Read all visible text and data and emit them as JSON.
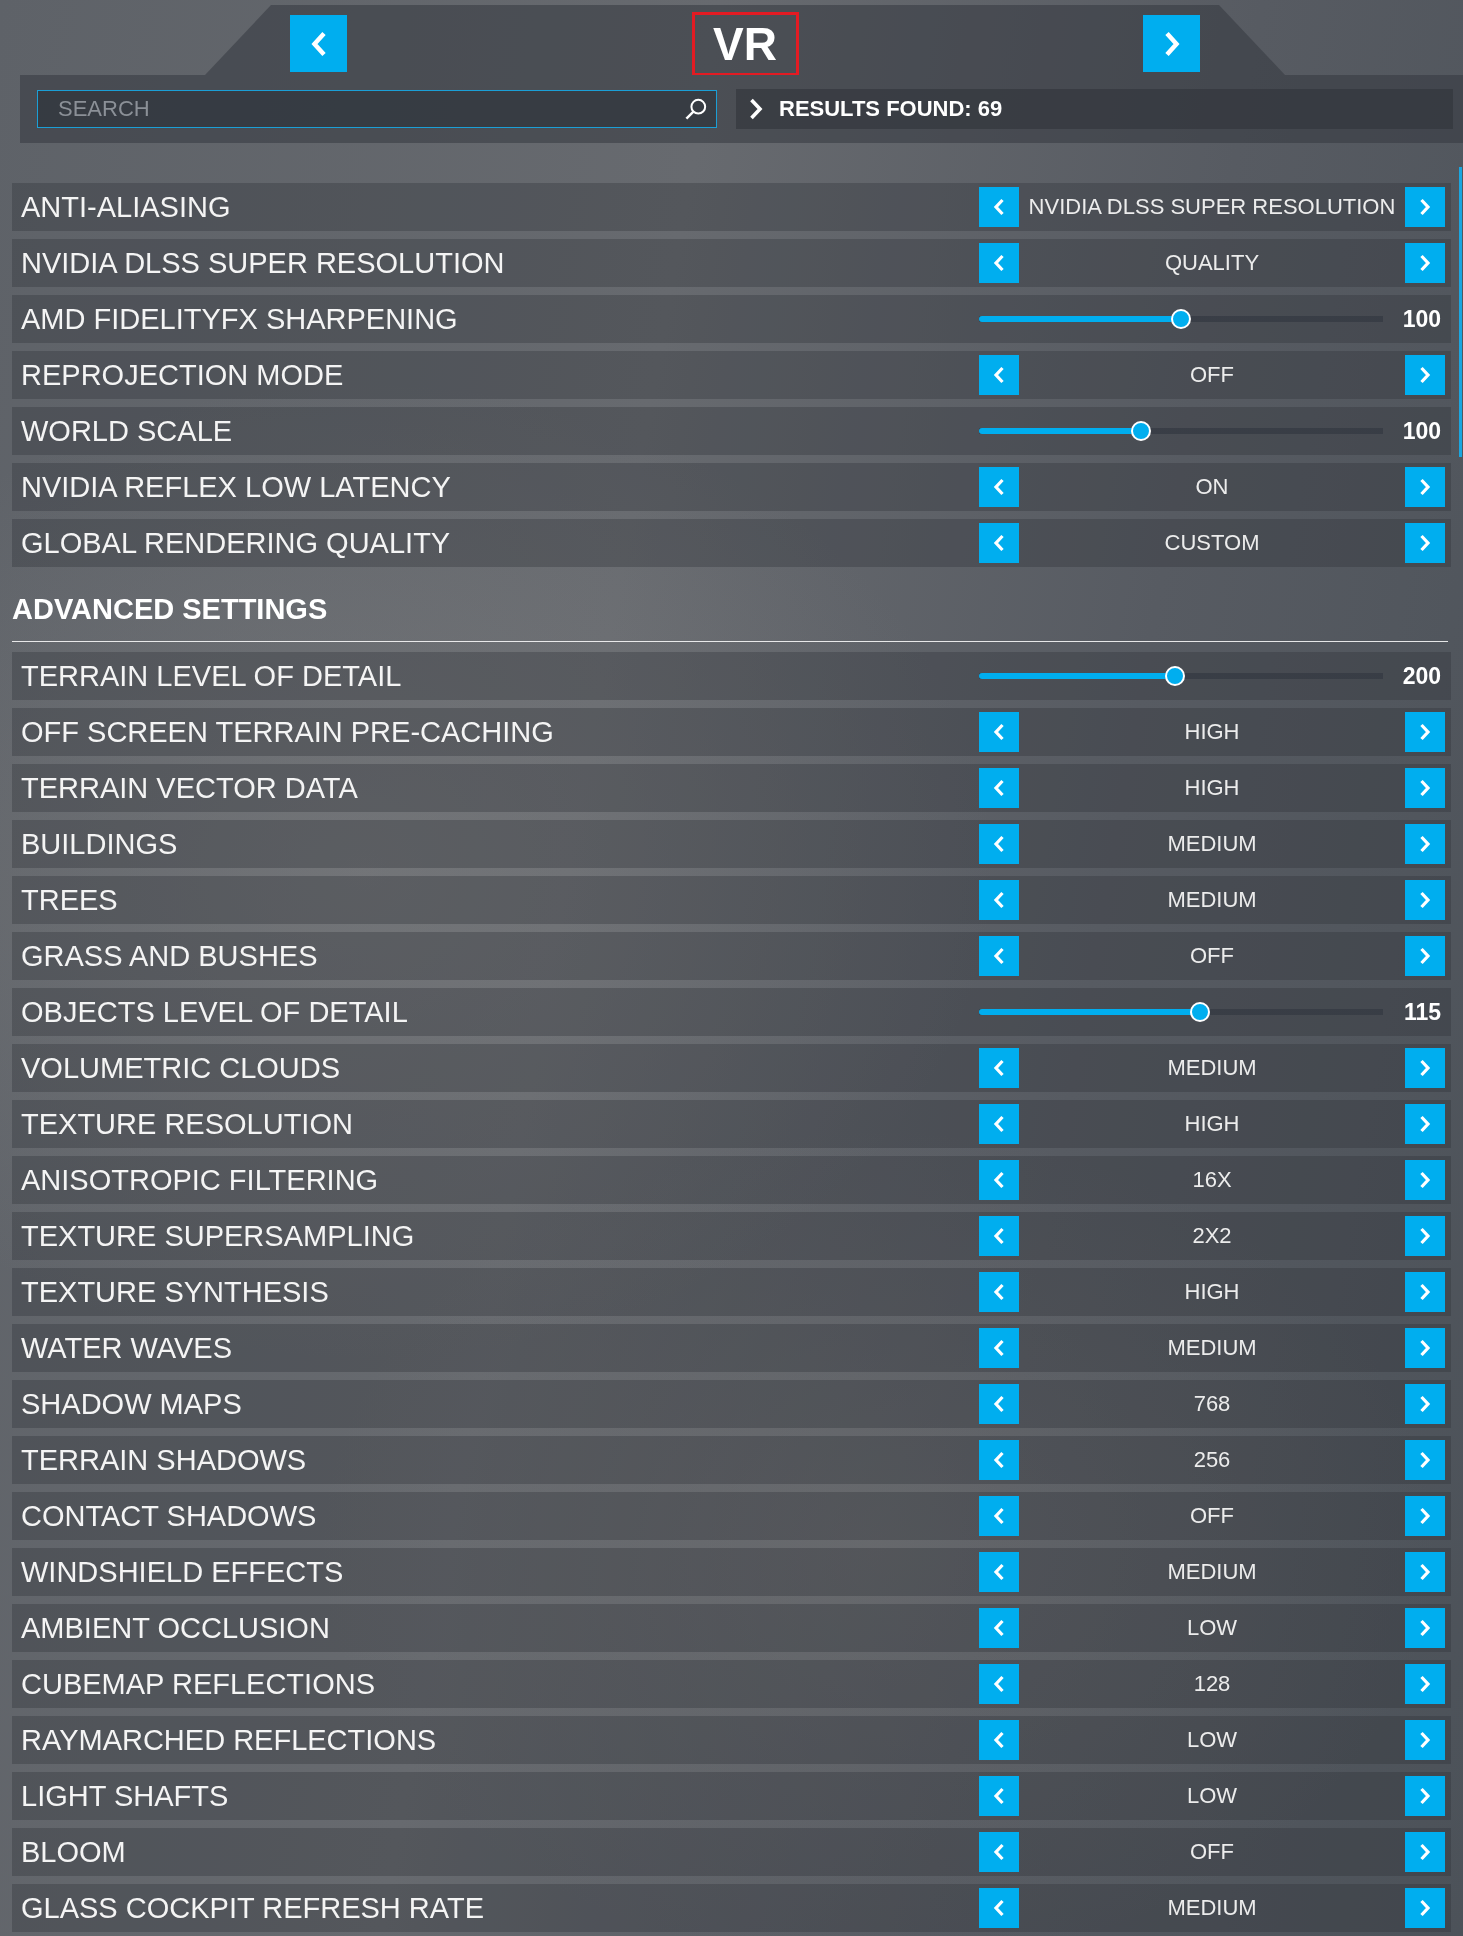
{
  "header": {
    "title": "VR"
  },
  "search": {
    "placeholder": "SEARCH"
  },
  "results": {
    "text": "RESULTS FOUND: 69"
  },
  "sections": [
    {
      "settings": [
        {
          "label": "ANTI-ALIASING",
          "kind": "selector",
          "value": "NVIDIA DLSS SUPER RESOLUTION"
        },
        {
          "label": "NVIDIA DLSS SUPER RESOLUTION",
          "kind": "selector",
          "value": "QUALITY"
        },
        {
          "label": "AMD FIDELITYFX SHARPENING",
          "kind": "slider",
          "level": 0.5,
          "reading": "100"
        },
        {
          "label": "REPROJECTION MODE",
          "kind": "selector",
          "value": "OFF"
        },
        {
          "label": "WORLD SCALE",
          "kind": "slider",
          "level": 0.4,
          "reading": "100"
        },
        {
          "label": "NVIDIA REFLEX LOW LATENCY",
          "kind": "selector",
          "value": "ON"
        },
        {
          "label": "GLOBAL RENDERING QUALITY",
          "kind": "selector",
          "value": "CUSTOM"
        }
      ]
    },
    {
      "heading": "ADVANCED SETTINGS",
      "settings": [
        {
          "label": "TERRAIN LEVEL OF DETAIL",
          "kind": "slider",
          "level": 0.485,
          "reading": "200"
        },
        {
          "label": "OFF SCREEN TERRAIN PRE-CACHING",
          "kind": "selector",
          "value": "HIGH"
        },
        {
          "label": "TERRAIN VECTOR DATA",
          "kind": "selector",
          "value": "HIGH"
        },
        {
          "label": "BUILDINGS",
          "kind": "selector",
          "value": "MEDIUM"
        },
        {
          "label": "TREES",
          "kind": "selector",
          "value": "MEDIUM"
        },
        {
          "label": "GRASS AND BUSHES",
          "kind": "selector",
          "value": "OFF"
        },
        {
          "label": "OBJECTS LEVEL OF DETAIL",
          "kind": "slider",
          "level": 0.547,
          "reading": "115"
        },
        {
          "label": "VOLUMETRIC CLOUDS",
          "kind": "selector",
          "value": "MEDIUM"
        },
        {
          "label": "TEXTURE RESOLUTION",
          "kind": "selector",
          "value": "HIGH"
        },
        {
          "label": "ANISOTROPIC FILTERING",
          "kind": "selector",
          "value": "16X"
        },
        {
          "label": "TEXTURE SUPERSAMPLING",
          "kind": "selector",
          "value": "2X2"
        },
        {
          "label": "TEXTURE SYNTHESIS",
          "kind": "selector",
          "value": "HIGH"
        },
        {
          "label": "WATER WAVES",
          "kind": "selector",
          "value": "MEDIUM"
        },
        {
          "label": "SHADOW MAPS",
          "kind": "selector",
          "value": "768"
        },
        {
          "label": "TERRAIN SHADOWS",
          "kind": "selector",
          "value": "256"
        },
        {
          "label": "CONTACT SHADOWS",
          "kind": "selector",
          "value": "OFF"
        },
        {
          "label": "WINDSHIELD EFFECTS",
          "kind": "selector",
          "value": "MEDIUM"
        },
        {
          "label": "AMBIENT OCCLUSION",
          "kind": "selector",
          "value": "LOW"
        },
        {
          "label": "CUBEMAP REFLECTIONS",
          "kind": "selector",
          "value": "128"
        },
        {
          "label": "RAYMARCHED REFLECTIONS",
          "kind": "selector",
          "value": "LOW"
        },
        {
          "label": "LIGHT SHAFTS",
          "kind": "selector",
          "value": "LOW"
        },
        {
          "label": "BLOOM",
          "kind": "selector",
          "value": "OFF"
        },
        {
          "label": "GLASS COCKPIT REFRESH RATE",
          "kind": "selector",
          "value": "MEDIUM"
        }
      ]
    }
  ]
}
